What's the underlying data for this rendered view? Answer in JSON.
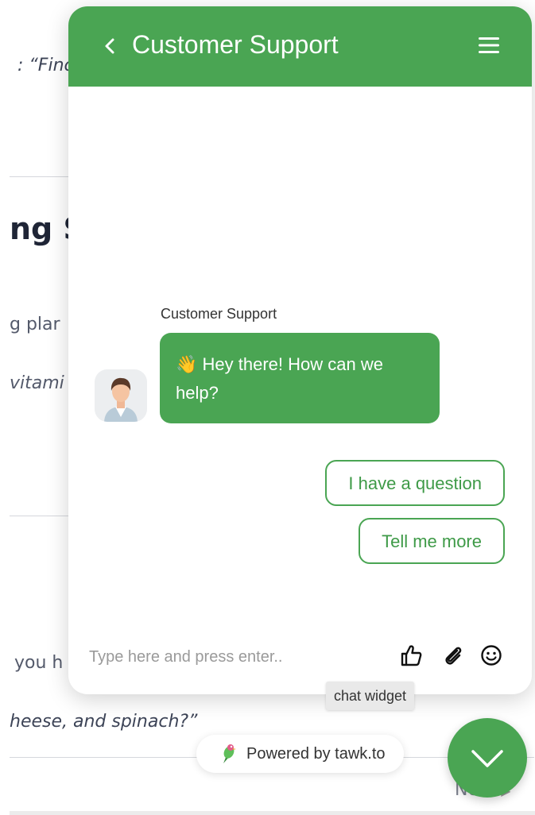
{
  "background": {
    "quote_top": ": “Finc",
    "heading": "ng Sc",
    "plan_text": "g plar",
    "vitamin_text": "vitami",
    "you_text": "you h",
    "cheese_text": "heese, and spinach?”",
    "next_text": "Next"
  },
  "chat": {
    "header_title": "Customer Support",
    "agent_name": "Customer Support",
    "greeting_emoji": "👋",
    "greeting_text": "Hey there! How can we help?",
    "quick_replies": [
      "I have a question",
      "Tell me more"
    ],
    "composer_placeholder": "Type here and press enter..",
    "tooltip": "chat widget",
    "powered_by": "Powered by tawk.to"
  },
  "colors": {
    "brand_green": "#4aa553",
    "text_dark": "#1f2536"
  },
  "icons": {
    "back": "chevron-left-icon",
    "menu": "hamburger-menu-icon",
    "rating": "thumbs-up-icon",
    "attach": "paperclip-icon",
    "emoji": "smiley-icon",
    "minimize": "chevron-down-icon"
  }
}
